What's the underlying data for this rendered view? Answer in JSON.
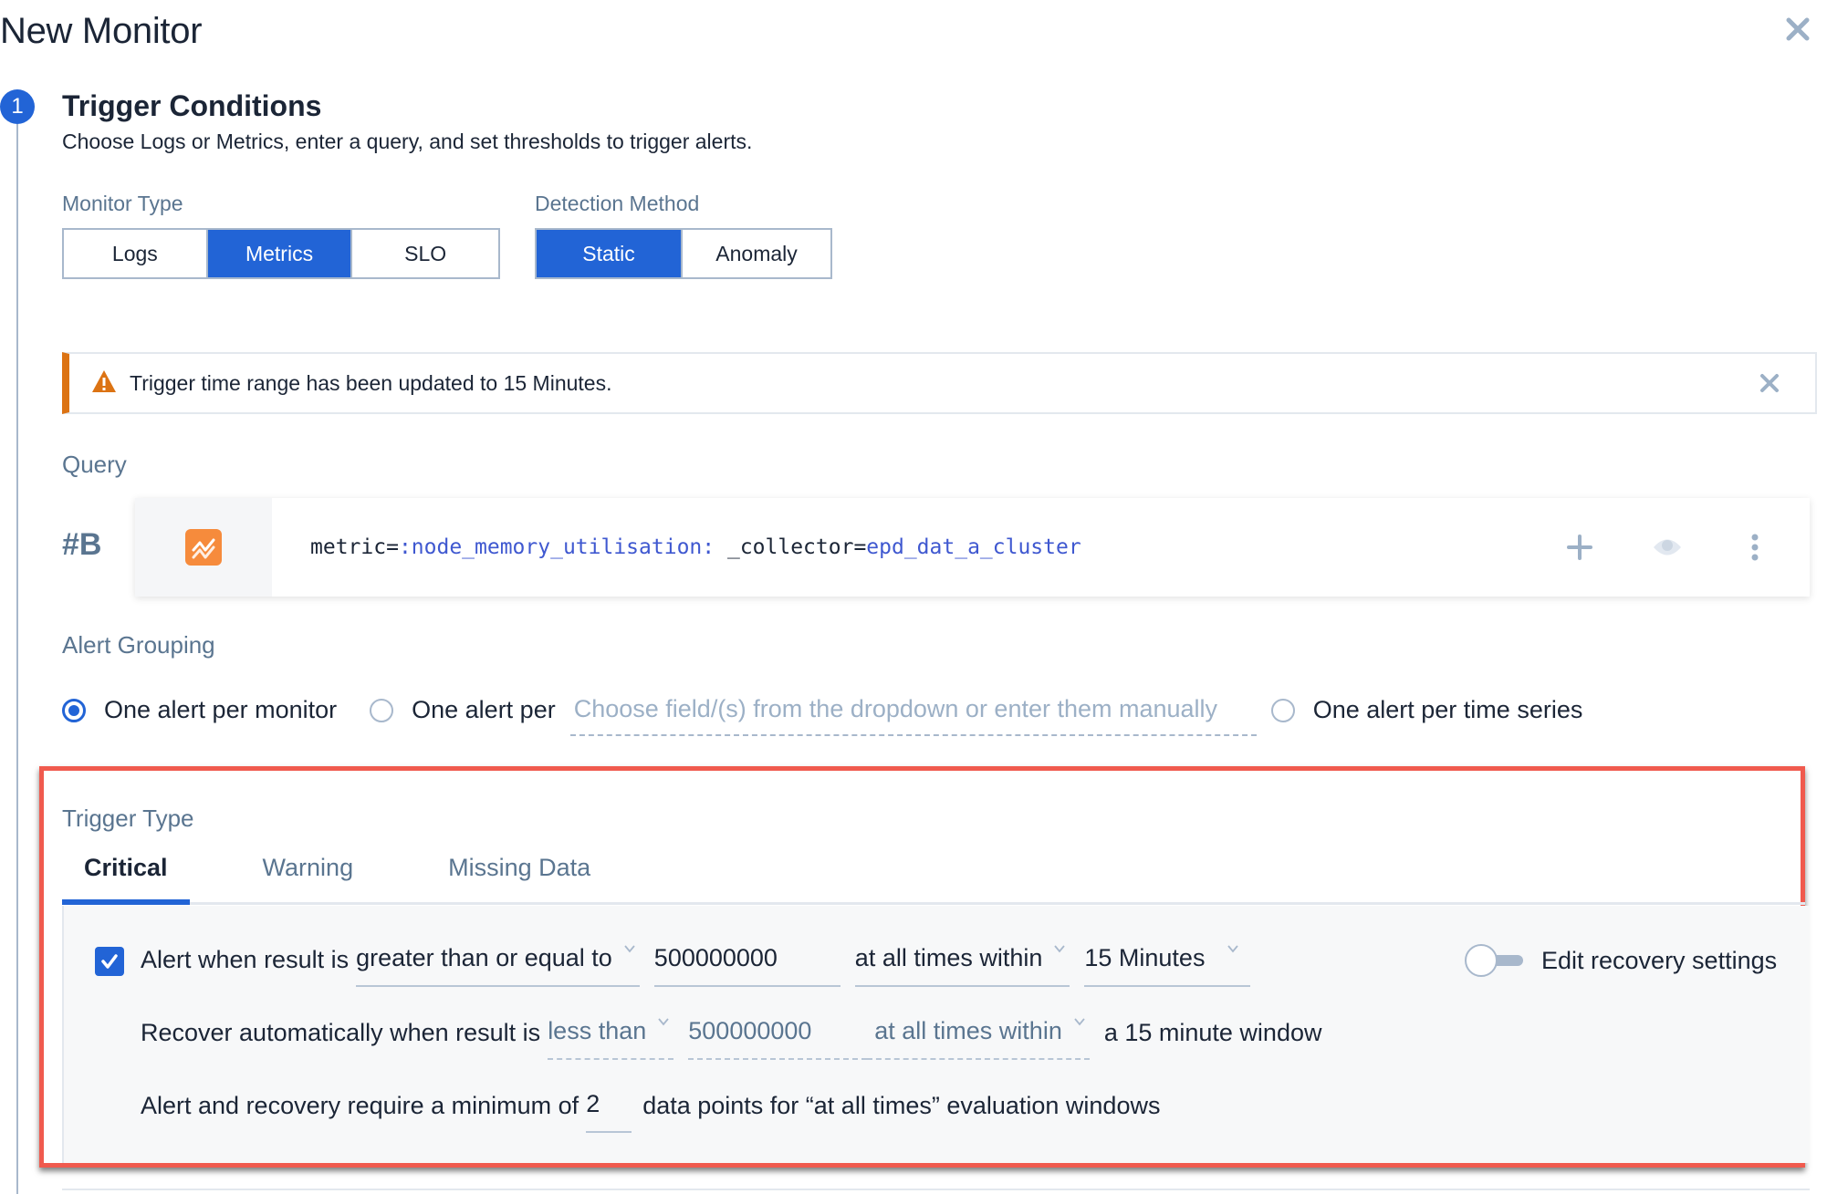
{
  "page": {
    "title": "New Monitor"
  },
  "step": {
    "number": "1",
    "title": "Trigger Conditions",
    "subtitle": "Choose Logs or Metrics, enter a query, and set thresholds to trigger alerts."
  },
  "monitor_type": {
    "label": "Monitor Type",
    "options": [
      "Logs",
      "Metrics",
      "SLO"
    ],
    "selected": "Metrics"
  },
  "detection_method": {
    "label": "Detection Method",
    "options": [
      "Static",
      "Anomaly"
    ],
    "selected": "Static"
  },
  "banner": {
    "type": "warning",
    "text": "Trigger time range has been updated to 15 Minutes."
  },
  "query": {
    "label": "Query",
    "id": "#B",
    "parts": {
      "key1": "metric=",
      "val1": ":node_memory_utilisation:",
      "sep": " _collector=",
      "val2": "epd_dat_a_cluster"
    }
  },
  "alert_grouping": {
    "label": "Alert Grouping",
    "options": {
      "per_monitor": "One alert per monitor",
      "per_field": "One alert per",
      "per_series": "One alert per time series"
    },
    "field_placeholder": "Choose field/(s) from the dropdown or enter them manually",
    "selected": "per_monitor"
  },
  "trigger_type": {
    "label": "Trigger Type",
    "tabs": [
      "Critical",
      "Warning",
      "Missing Data"
    ],
    "active_tab": "Critical"
  },
  "critical": {
    "enabled": true,
    "alert_prefix": "Alert when result is",
    "alert_operator": "greater than or equal to",
    "alert_threshold": "500000000",
    "alert_occurrence": "at all times within",
    "alert_window": "15 Minutes",
    "recover_prefix": "Recover automatically when result is",
    "recover_operator": "less than",
    "recover_threshold": "500000000",
    "recover_occurrence": "at all times within",
    "recover_window_text": "a 15 minute window",
    "min_prefix": "Alert and recovery require a minimum of",
    "min_points": "2",
    "min_suffix": "data points for “at all times” evaluation windows",
    "edit_recovery_label": "Edit recovery settings",
    "edit_recovery_on": false
  },
  "colors": {
    "accent": "#2264d6",
    "warning": "#dc7313",
    "highlight": "#f05a4e",
    "metric_icon": "#f68b3c"
  }
}
